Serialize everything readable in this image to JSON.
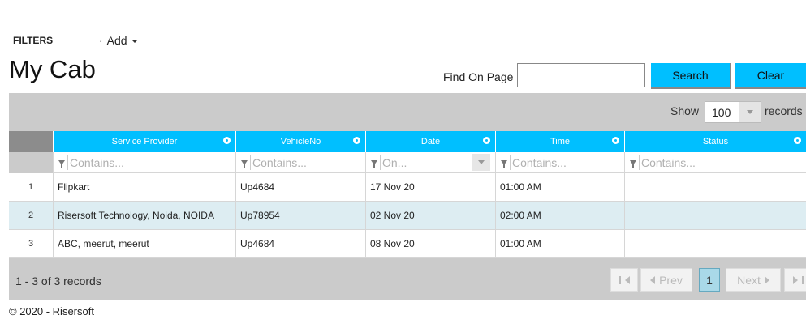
{
  "header": {
    "filters_label": "FILTERS",
    "add_menu_label": "Add",
    "page_title": "My Cab",
    "find_label": "Find On Page",
    "find_value": "",
    "search_button": "Search",
    "clear_button": "Clear"
  },
  "grid": {
    "show_label": "Show",
    "page_size": "100",
    "records_label": "records",
    "columns": [
      "Service Provider",
      "VehicleNo",
      "Date",
      "Time",
      "Status"
    ],
    "filter_placeholders": [
      "Contains...",
      "Contains...",
      "On...",
      "Contains...",
      "Contains..."
    ],
    "rows": [
      {
        "num": "1",
        "provider": "Flipkart",
        "vehicle": "Up4684",
        "date": "17 Nov 20",
        "time": "01:00 AM",
        "status": ""
      },
      {
        "num": "2",
        "provider": "Risersoft Technology, Noida, NOIDA",
        "vehicle": "Up78954",
        "date": "02 Nov 20",
        "time": "02:00 AM",
        "status": ""
      },
      {
        "num": "3",
        "provider": "ABC, meerut, meerut",
        "vehicle": "Up4684",
        "date": "08 Nov 20",
        "time": "01:00 AM",
        "status": ""
      }
    ],
    "summary": "1 - 3 of 3 records",
    "pager": {
      "prev": "Prev",
      "next": "Next",
      "current_page": "1"
    }
  },
  "footer": {
    "copyright": "© 2020 - Risersoft"
  },
  "colors": {
    "accent": "#00bfff",
    "alt_row": "#ddedf2",
    "toolbar": "#cbcbcb"
  },
  "icons": [
    "caret-down-icon",
    "gear-icon",
    "filter-icon",
    "first-page-icon",
    "prev-icon",
    "next-icon",
    "last-page-icon"
  ]
}
